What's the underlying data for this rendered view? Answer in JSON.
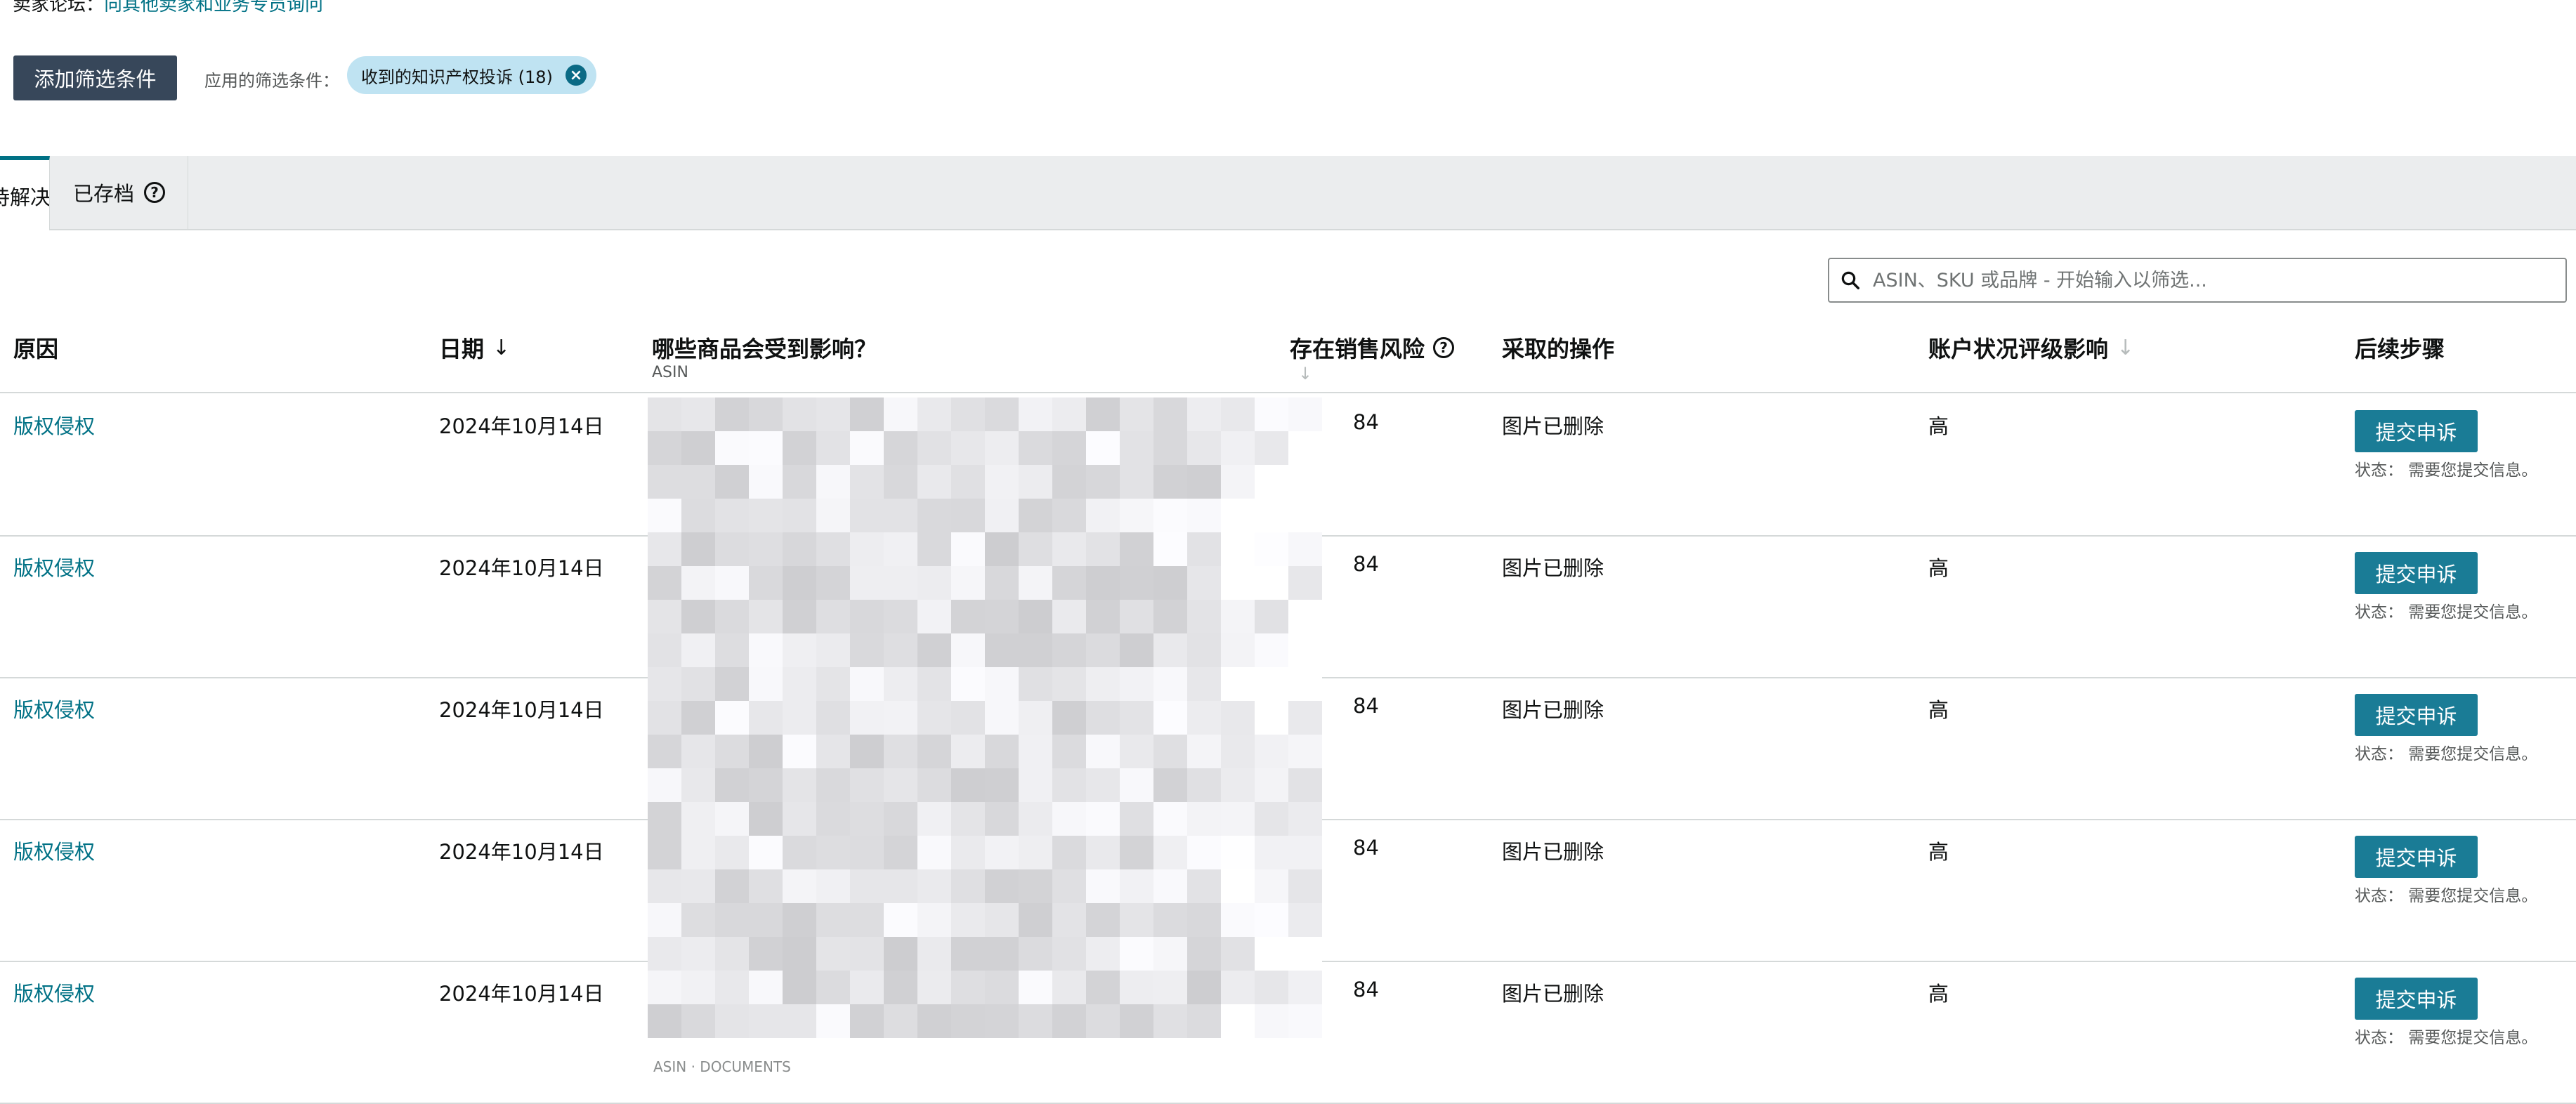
{
  "forum_line": {
    "prefix": "卖家论坛：",
    "link": "向其他卖家和业务专员询问"
  },
  "filters": {
    "add_button": "添加筛选条件",
    "applied_label": "应用的筛选条件：",
    "chip_label": "收到的知识产权投诉 (18)",
    "chip_close": "×"
  },
  "tabs": {
    "active": "待解决",
    "archived": "已存档",
    "help": "?"
  },
  "search": {
    "placeholder": "ASIN、SKU 或品牌 - 开始输入以筛选..."
  },
  "table": {
    "headers": {
      "reason": "原因",
      "date": "日期",
      "date_sort": "↓",
      "affected": "哪些商品会受到影响？",
      "affected_sub": "ASIN",
      "risk": "存在销售风险",
      "risk_help": "?",
      "risk_sort": "↓",
      "action": "采取的操作",
      "health": "账户状况评级影响",
      "health_sort": "↓",
      "next": "后续步骤"
    },
    "rows": [
      {
        "reason": "版权侵权",
        "date": "2024年10月14日",
        "risk": "84",
        "action": "图片已删除",
        "impact": "高",
        "button": "提交申诉",
        "status": "状态： 需要您提交信息。"
      },
      {
        "reason": "版权侵权",
        "date": "2024年10月14日",
        "risk": "84",
        "action": "图片已删除",
        "impact": "高",
        "button": "提交申诉",
        "status": "状态： 需要您提交信息。"
      },
      {
        "reason": "版权侵权",
        "date": "2024年10月14日",
        "risk": "84",
        "action": "图片已删除",
        "impact": "高",
        "button": "提交申诉",
        "status": "状态： 需要您提交信息。"
      },
      {
        "reason": "版权侵权",
        "date": "2024年10月14日",
        "risk": "84",
        "action": "图片已删除",
        "impact": "高",
        "button": "提交申诉",
        "status": "状态： 需要您提交信息。"
      },
      {
        "reason": "版权侵权",
        "date": "2024年10月14日",
        "risk": "84",
        "action": "图片已删除",
        "impact": "高",
        "button": "提交申诉",
        "status": "状态： 需要您提交信息。"
      }
    ],
    "footer_partial": "ASIN · DOCUMENTS"
  },
  "colors": {
    "primary_dark": "#37475a",
    "link": "#007185",
    "appeal_button": "#1a7c96",
    "chip_bg": "#bfe3f2",
    "tab_bar": "#ebedee"
  }
}
